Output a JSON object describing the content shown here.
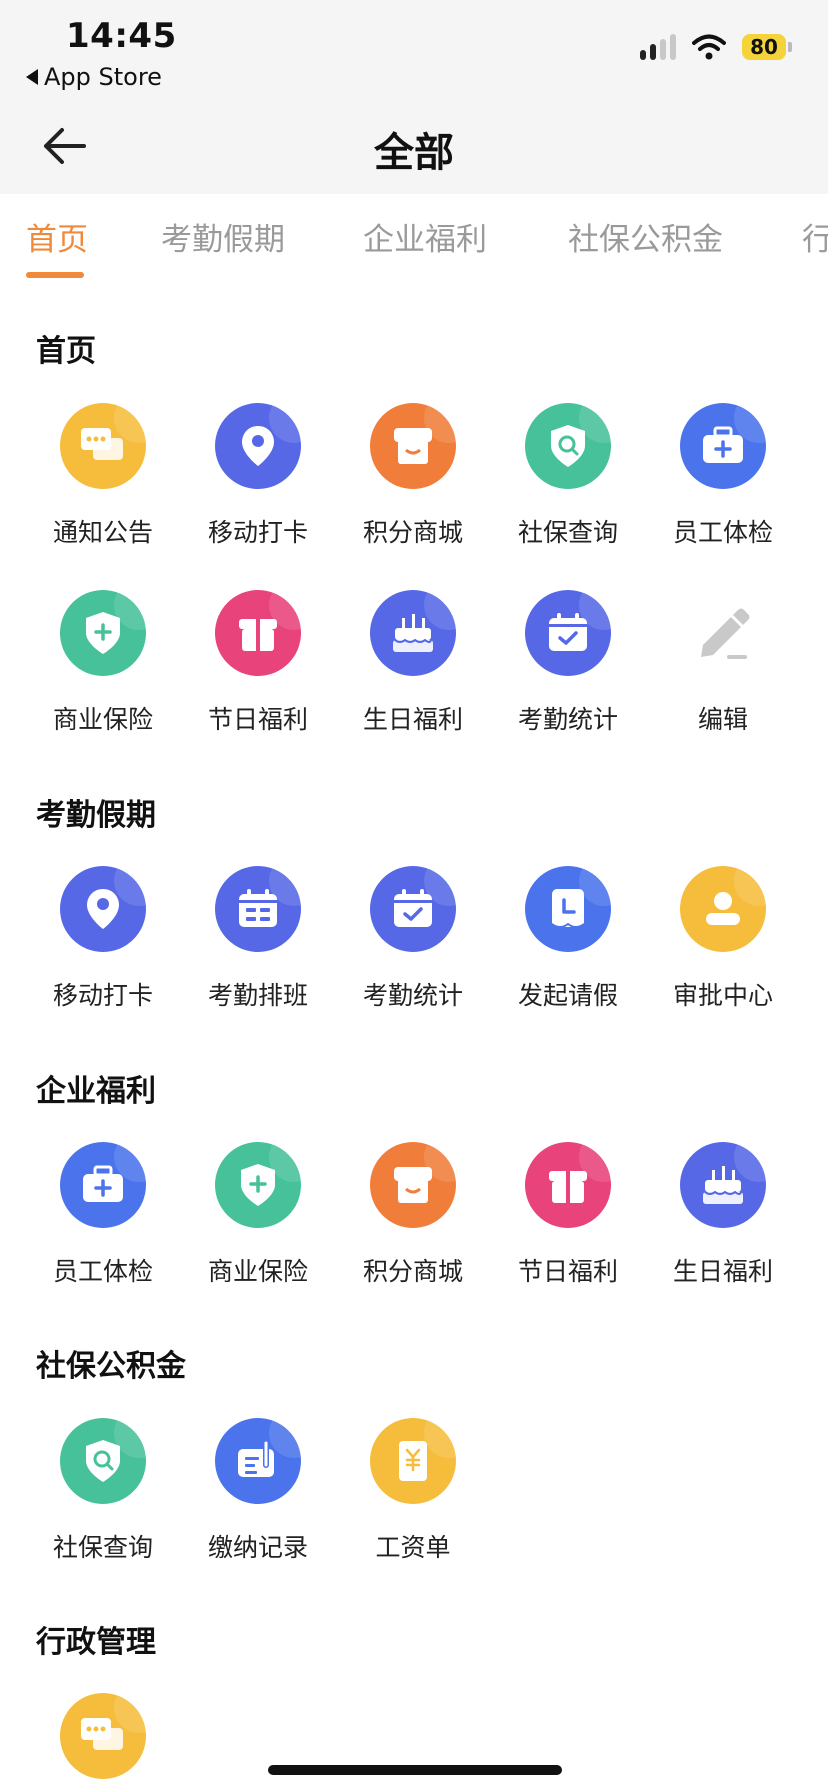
{
  "status_bar": {
    "time": "14:45",
    "back_app": "App Store",
    "battery": "80"
  },
  "header": {
    "title": "全部"
  },
  "tabs": [
    {
      "label": "首页",
      "active": true
    },
    {
      "label": "考勤假期",
      "active": false
    },
    {
      "label": "企业福利",
      "active": false
    },
    {
      "label": "社保公积金",
      "active": false
    },
    {
      "label": "行",
      "active": false
    }
  ],
  "sections": [
    {
      "title": "首页",
      "items": [
        {
          "label": "通知公告",
          "icon": "chat-icon",
          "color": "#f6bd3c"
        },
        {
          "label": "移动打卡",
          "icon": "location-pin-icon",
          "color": "#5668e6"
        },
        {
          "label": "积分商城",
          "icon": "shop-icon",
          "color": "#f07e3a"
        },
        {
          "label": "社保查询",
          "icon": "shield-search-icon",
          "color": "#47c199"
        },
        {
          "label": "员工体检",
          "icon": "medical-kit-icon",
          "color": "#4a73ec"
        },
        {
          "label": "商业保险",
          "icon": "shield-plus-icon",
          "color": "#47c199"
        },
        {
          "label": "节日福利",
          "icon": "gift-icon",
          "color": "#e8437a"
        },
        {
          "label": "生日福利",
          "icon": "cake-icon",
          "color": "#5668e6"
        },
        {
          "label": "考勤统计",
          "icon": "calendar-check-icon",
          "color": "#5668e6"
        },
        {
          "label": "编辑",
          "icon": "edit-icon",
          "color": "#cccccc"
        }
      ]
    },
    {
      "title": "考勤假期",
      "items": [
        {
          "label": "移动打卡",
          "icon": "location-pin-icon",
          "color": "#5668e6"
        },
        {
          "label": "考勤排班",
          "icon": "calendar-grid-icon",
          "color": "#5668e6"
        },
        {
          "label": "考勤统计",
          "icon": "calendar-check-icon",
          "color": "#5668e6"
        },
        {
          "label": "发起请假",
          "icon": "leave-clock-icon",
          "color": "#4a73ec"
        },
        {
          "label": "审批中心",
          "icon": "user-icon",
          "color": "#f6bd3c"
        }
      ]
    },
    {
      "title": "企业福利",
      "items": [
        {
          "label": "员工体检",
          "icon": "medical-kit-icon",
          "color": "#4a73ec"
        },
        {
          "label": "商业保险",
          "icon": "shield-plus-icon",
          "color": "#47c199"
        },
        {
          "label": "积分商城",
          "icon": "shop-icon",
          "color": "#f07e3a"
        },
        {
          "label": "节日福利",
          "icon": "gift-icon",
          "color": "#e8437a"
        },
        {
          "label": "生日福利",
          "icon": "cake-icon",
          "color": "#5668e6"
        }
      ]
    },
    {
      "title": "社保公积金",
      "items": [
        {
          "label": "社保查询",
          "icon": "shield-search-icon",
          "color": "#47c199"
        },
        {
          "label": "缴纳记录",
          "icon": "record-pen-icon",
          "color": "#4a73ec"
        },
        {
          "label": "工资单",
          "icon": "payslip-yuan-icon",
          "color": "#f6bd3c"
        }
      ]
    },
    {
      "title": "行政管理",
      "items": [
        {
          "label": "",
          "icon": "chat-icon",
          "color": "#f6bd3c"
        }
      ]
    }
  ]
}
